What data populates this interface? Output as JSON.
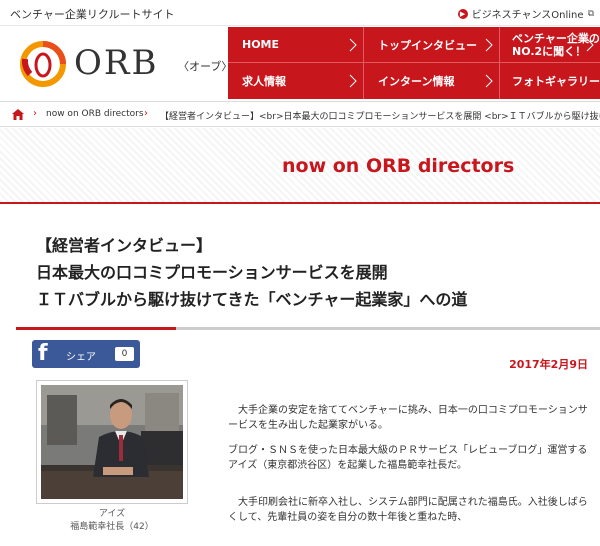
{
  "top": {
    "site_title": "ベンチャー企業リクルートサイト",
    "external_link": "ビジネスチャンスOnline"
  },
  "header": {
    "logo_text": "ORB",
    "logo_sub": "〈オーブ〉"
  },
  "nav": {
    "items": [
      {
        "label": "HOME"
      },
      {
        "label": "トップインタビュー"
      },
      {
        "label": "ベンチャー企業の\nNO.2に聞く！"
      },
      {
        "label": "求人情報"
      },
      {
        "label": "インターン情報"
      },
      {
        "label": "フォトギャラリー"
      }
    ]
  },
  "breadcrumb": {
    "item1": "now on ORB directors",
    "item2": "【経営者インタビュー】<br>日本最大の口コミプロモーションサービスを展開 <br>ＩＴバブルから駆け抜けてきた"
  },
  "banner": {
    "title": "now on ORB directors"
  },
  "article": {
    "title_lines": [
      "【経営者インタビュー】",
      "日本最大の口コミプロモーションサービスを展開",
      "ＩＴバブルから駆け抜けてきた「ベンチャー起業家」への道"
    ],
    "date": "2017年2月9日",
    "caption_line1": "アイズ",
    "caption_line2": "福島範幸社長（42）",
    "paragraphs": [
      "大手企業の安定を捨ててベンチャーに挑み、日本一の口コミプロモーションサービスを生み出した起業家がいる。",
      "ブログ・ＳＮＳを使った日本最大級のＰＲサービス「レビューブログ」運営するアイズ（東京都渋谷区）を起業した福島範幸社長だ。",
      "大手印刷会社に新卒入社し、システム部門に配属された福島氏。入社後しばらくして、先輩社員の姿を自分の数十年後と重ねた時、"
    ]
  },
  "share": {
    "icon": "f",
    "label": "シェア",
    "count": "0"
  },
  "colors": {
    "brand_red": "#c8161d",
    "facebook_blue": "#3b5998",
    "logo_orange": "#f39800"
  }
}
